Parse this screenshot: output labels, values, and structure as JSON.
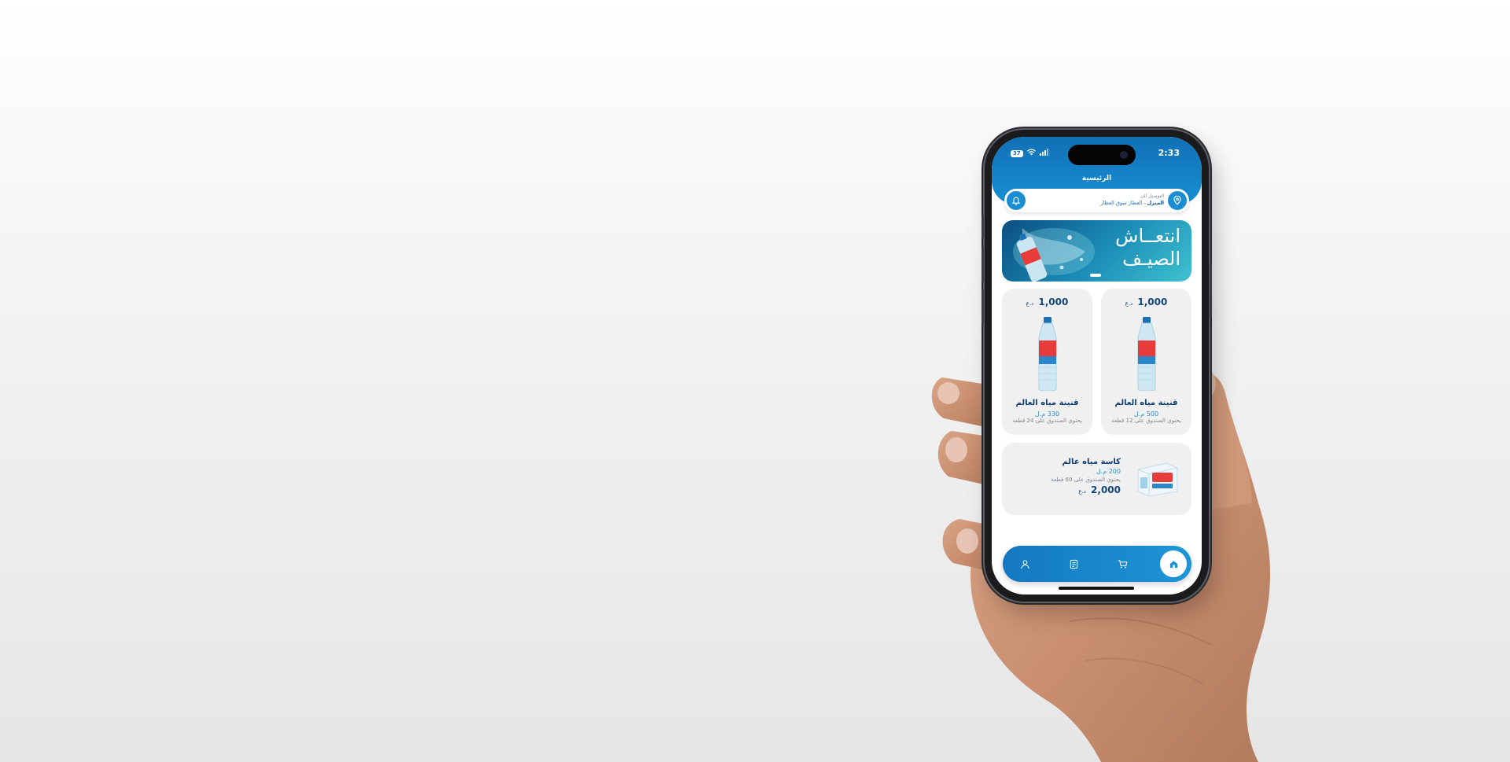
{
  "status": {
    "time": "2:33",
    "battery": "37"
  },
  "header": {
    "title": "الرئيسية"
  },
  "location": {
    "line1": "التوصيل الى",
    "place_bold": "المنزل",
    "place_rest": " - العطار سوق العطار"
  },
  "banner": {
    "text_line1": "انتعــاش",
    "text_line2": "الصيـف"
  },
  "products": [
    {
      "price": "1,000",
      "currency": "د.ع",
      "name": "قنينة مياه العالم",
      "size": "500 م.ل",
      "desc": "يحتوي الصندوق على 12 قطعة"
    },
    {
      "price": "1,000",
      "currency": "د.ع",
      "name": "قنينة مياه العالم",
      "size": "330 م.ل",
      "desc": "يحتوي الصندوق على 24 قطعة"
    }
  ],
  "featured": {
    "name": "كاسة مياه عالم",
    "size": "200 م.ل",
    "desc": "يحتوي الصندوق على 60 قطعة",
    "price": "2,000",
    "currency": "د.ع"
  },
  "nav": {
    "items": [
      "home-icon",
      "cart-icon",
      "orders-icon",
      "profile-icon"
    ]
  },
  "colors": {
    "primary": "#1b8ed3",
    "dark_blue": "#0f3e75",
    "card_bg": "#f0f0f1"
  }
}
